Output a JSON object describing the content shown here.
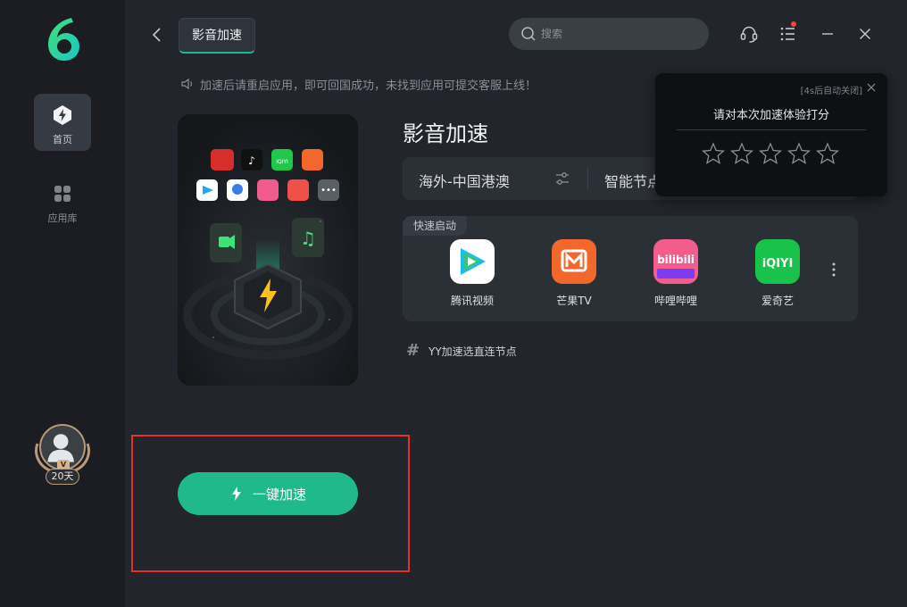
{
  "sidebar": {
    "items": [
      {
        "label": "首页",
        "icon": "lightning-home-icon",
        "active": true
      },
      {
        "label": "应用库",
        "icon": "app-grid-icon",
        "active": false
      }
    ],
    "profile": {
      "days_badge": "20天",
      "vip_mark": "V"
    }
  },
  "header": {
    "tab_label": "影音加速",
    "search_placeholder": "搜索"
  },
  "notice": "加速后请重启应用，即可回国成功，未找到应用可提交客服上线！",
  "main": {
    "title": "影音加速",
    "node_region": "海外-中国港澳",
    "node_mode": "智能节点",
    "quick_launch_label": "快速启动",
    "apps": [
      {
        "name": "腾讯视频",
        "icon": "tencent-video-icon"
      },
      {
        "name": "芒果TV",
        "icon": "mango-tv-icon"
      },
      {
        "name": "哔哩哔哩",
        "icon": "bilibili-icon"
      },
      {
        "name": "爱奇艺",
        "icon": "iqiyi-icon"
      }
    ],
    "yy_text": "YY加速选直连节点",
    "boost_label": "一键加速"
  },
  "rating_popup": {
    "auto_close": "[4s后自动关闭]",
    "title": "请对本次加速体验打分",
    "stars_total": 5
  },
  "colors": {
    "accent": "#1fb98c",
    "background": "#22252c",
    "sidebar": "#1b1d22",
    "highlight_box": "#e0322a"
  }
}
